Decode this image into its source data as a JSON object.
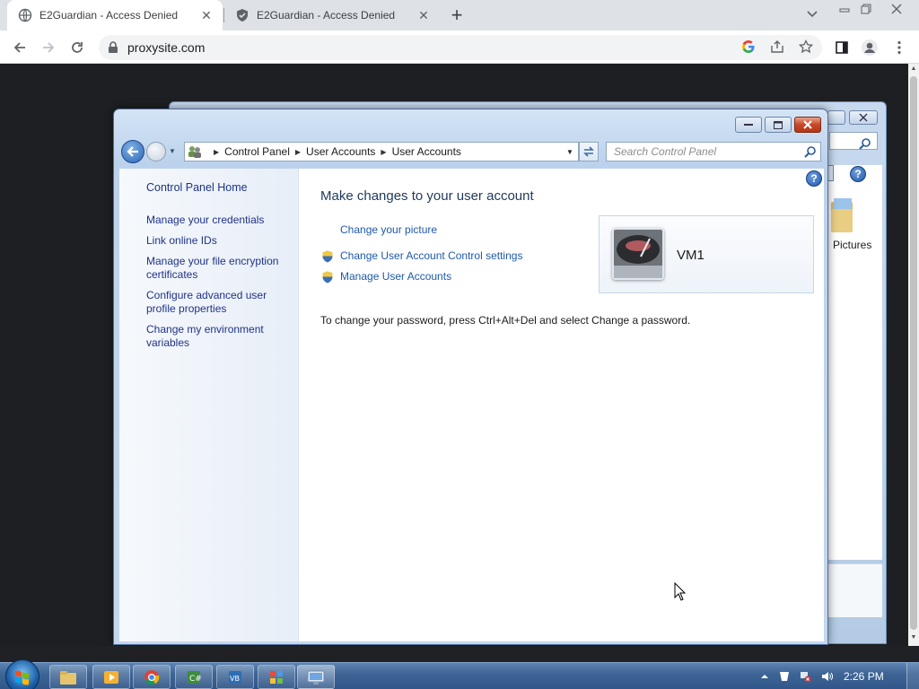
{
  "browser": {
    "tabs": [
      {
        "title": "E2Guardian - Access Denied",
        "active": true
      },
      {
        "title": "E2Guardian - Access Denied",
        "active": false
      }
    ],
    "url": "proxysite.com"
  },
  "control_panel": {
    "breadcrumb": [
      "Control Panel",
      "User Accounts",
      "User Accounts"
    ],
    "search_placeholder": "Search Control Panel",
    "sidebar": {
      "home": "Control Panel Home",
      "links": [
        "Manage your credentials",
        "Link online IDs",
        "Manage your file encryption certificates",
        "Configure advanced user profile properties",
        "Change my environment variables"
      ]
    },
    "main": {
      "title": "Make changes to your user account",
      "tasks": [
        "Change your picture",
        "Change User Account Control settings",
        "Manage User Accounts"
      ],
      "password_note": "To change your password, press Ctrl+Alt+Del and select Change a password.",
      "user_name": "VM1"
    }
  },
  "background_window": {
    "folder_label": "Pictures"
  },
  "taskbar": {
    "clock": "2:26 PM",
    "apps": [
      "explorer-icon",
      "media-player-icon",
      "chrome-icon",
      "csharp-icon",
      "vb-icon",
      "control-panel-icon",
      "remote-desktop-icon"
    ]
  },
  "colors": {
    "link": "#1e5aa8",
    "sidebar_link": "#1e3287",
    "taskbar": "#3e6596",
    "close_button": "#c7472a"
  }
}
